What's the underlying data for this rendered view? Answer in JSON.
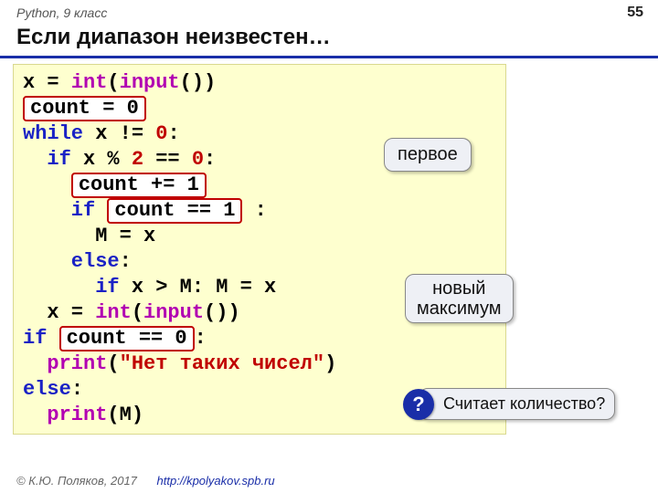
{
  "header": {
    "course": "Python, 9 класс",
    "page": "55"
  },
  "title": "Если диапазон неизвестен…",
  "code": {
    "l1_assign": "x = ",
    "l1_int": "int",
    "l1_open": "(",
    "l1_input": "input",
    "l1_close": "())",
    "l2_highlight": "count = 0",
    "l3_while": "while",
    "l3_rest": " x != ",
    "l3_zero": "0",
    "l3_colon": ":",
    "l4_if": "  if",
    "l4_rest": " x % ",
    "l4_two": "2",
    "l4_eq": " == ",
    "l4_zero": "0",
    "l4_colon": ":",
    "l5_pad": "    ",
    "l5_highlight": "count += 1",
    "l6_if": "    if",
    "l6_sp": " ",
    "l6_highlight": "count == 1",
    "l6_colon": " :",
    "l7": "      M = x",
    "l8_else": "    else",
    "l8_colon": ":",
    "l9_if": "      if",
    "l9_rest": " x > M: M = x",
    "l10_assign": "  x = ",
    "l10_int": "int",
    "l10_open": "(",
    "l10_input": "input",
    "l10_close": "())",
    "l11_if": "if",
    "l11_sp": " ",
    "l11_highlight": "count == 0",
    "l11_colon": ":",
    "l12_print": "  print",
    "l12_open": "(",
    "l12_str": "\"Нет таких чисел\"",
    "l12_close": ")",
    "l13_else": "else",
    "l13_colon": ":",
    "l14_print": "  print",
    "l14_arg": "(M)"
  },
  "callouts": {
    "first": "первое",
    "max_l1": "новый",
    "max_l2": "максимум",
    "question": "Считает количество?",
    "q_badge": "?"
  },
  "footer": {
    "copy": "© К.Ю. Поляков, 2017",
    "url": "http://kpolyakov.spb.ru"
  }
}
